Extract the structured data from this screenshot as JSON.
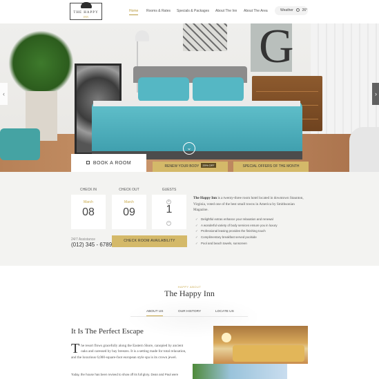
{
  "header": {
    "logo": {
      "name": "THE HAPPY",
      "sub": "INN"
    },
    "nav": [
      "Home",
      "Rooms & Rates",
      "Specials & Packages",
      "About The Inn",
      "About The Area"
    ],
    "active_nav": "Home",
    "weather": {
      "label": "Weather",
      "temp": "26°"
    }
  },
  "hero": {
    "prev_icon": "‹",
    "next_icon": "›",
    "scroll_icon": "⌄",
    "book_tab": "BOOK A ROOM",
    "promo1": {
      "label": "RENEW YOUR BODY",
      "badge": "20% OFF"
    },
    "promo2": "SPECIAL OFFERS OF THE MONTH"
  },
  "booking": {
    "checkin": {
      "label": "CHECK IN",
      "month": "March",
      "day": "08"
    },
    "checkout": {
      "label": "CHECK OUT",
      "month": "March",
      "day": "09"
    },
    "guests": {
      "label": "GUESTS",
      "value": "1"
    },
    "plus": "+",
    "minus": "–",
    "assistance_label": "24/7 Assistance",
    "phone": "(012) 345 - 6789",
    "availability_button": "CHECK ROOM AVAILABILITY",
    "intro_name": "The Happy Inn",
    "intro_text": " is a twenty-three room hotel located in downtown Staunton, Virginia, voted one of the best small towns in America by Smithsonian Magazine.",
    "amenities": [
      "Delightful extras enhance your relaxation and renewal",
      "A wonderful variety of body services ensure you in luxury",
      "Professional leasing provides the finishing touch",
      "Complimentary breakfast served poolside",
      "Pool and beach towels, sunscreen"
    ]
  },
  "about": {
    "kicker": "HAPPY ABOUT",
    "title": "The Happy Inn",
    "tabs": [
      "ABOUT US",
      "OUR HISTORY",
      "LOCATE US"
    ],
    "heading": "It Is The Perfect Escape",
    "drop_cap": "T",
    "body": "he resort flows gracefully along the Eastern Shore, canopied by ancient oaks and caressed by bay breezes. It is a setting made for total relaxation, and the luxurious 6,000-square-foot european style spa is its crown jewel.",
    "body2": "Today, the house has been revived to show off its full glory. Dean and Paul were"
  },
  "colors": {
    "accent": "#d4b969",
    "gold_text": "#c9a94b",
    "booking_bg": "#f3f3f1"
  }
}
